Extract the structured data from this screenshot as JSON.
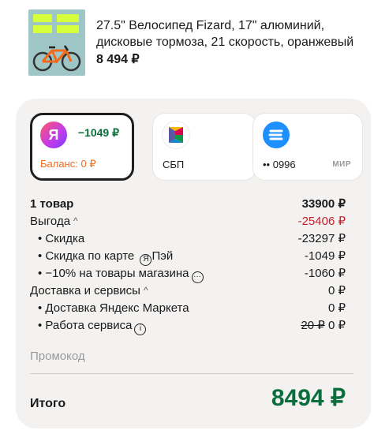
{
  "product": {
    "title": "27.5\" Велосипед Fizard, 17\" алюминий, дисковые тормоза, 21 скорость, оранжевый",
    "price": "8 494 ₽"
  },
  "payment_methods": [
    {
      "name": "yandex-pay",
      "logo_text": "Я",
      "amount": "−1049 ₽",
      "balance": "Баланс: 0 ₽",
      "selected": true
    },
    {
      "name": "sbp",
      "label": "СБП",
      "selected": false
    },
    {
      "name": "card",
      "label": "•• 0996",
      "network": "МИР",
      "selected": false
    }
  ],
  "summary": {
    "items": {
      "label": "1 товар",
      "value": "33900 ₽"
    },
    "benefit": {
      "label": "Выгода",
      "value": "-25406 ₽"
    },
    "discount": {
      "label": "•  Скидка",
      "value": "-23297 ₽"
    },
    "card_discount": {
      "label": "•  Скидка по карте",
      "icon_letter": "Я",
      "suffix": "Пэй",
      "value": "-1049 ₽"
    },
    "store_discount": {
      "label": "•  −10% на товары магазина",
      "value": "-1060 ₽"
    },
    "delivery_services": {
      "label": "Доставка и сервисы",
      "value": "0 ₽"
    },
    "delivery": {
      "label": "•  Доставка Яндекс Маркета",
      "value": "0 ₽"
    },
    "service": {
      "label": "•  Работа сервиса",
      "old_value": "20 ₽",
      "value": "0 ₽"
    }
  },
  "promo": {
    "placeholder": "Промокод"
  },
  "total": {
    "label": "Итого",
    "value": "8494 ₽"
  },
  "colors": {
    "accent_green": "#0a6e3c",
    "red": "#c8212a",
    "orange": "#f26b1d",
    "card_bg": "#f3f2f1"
  }
}
